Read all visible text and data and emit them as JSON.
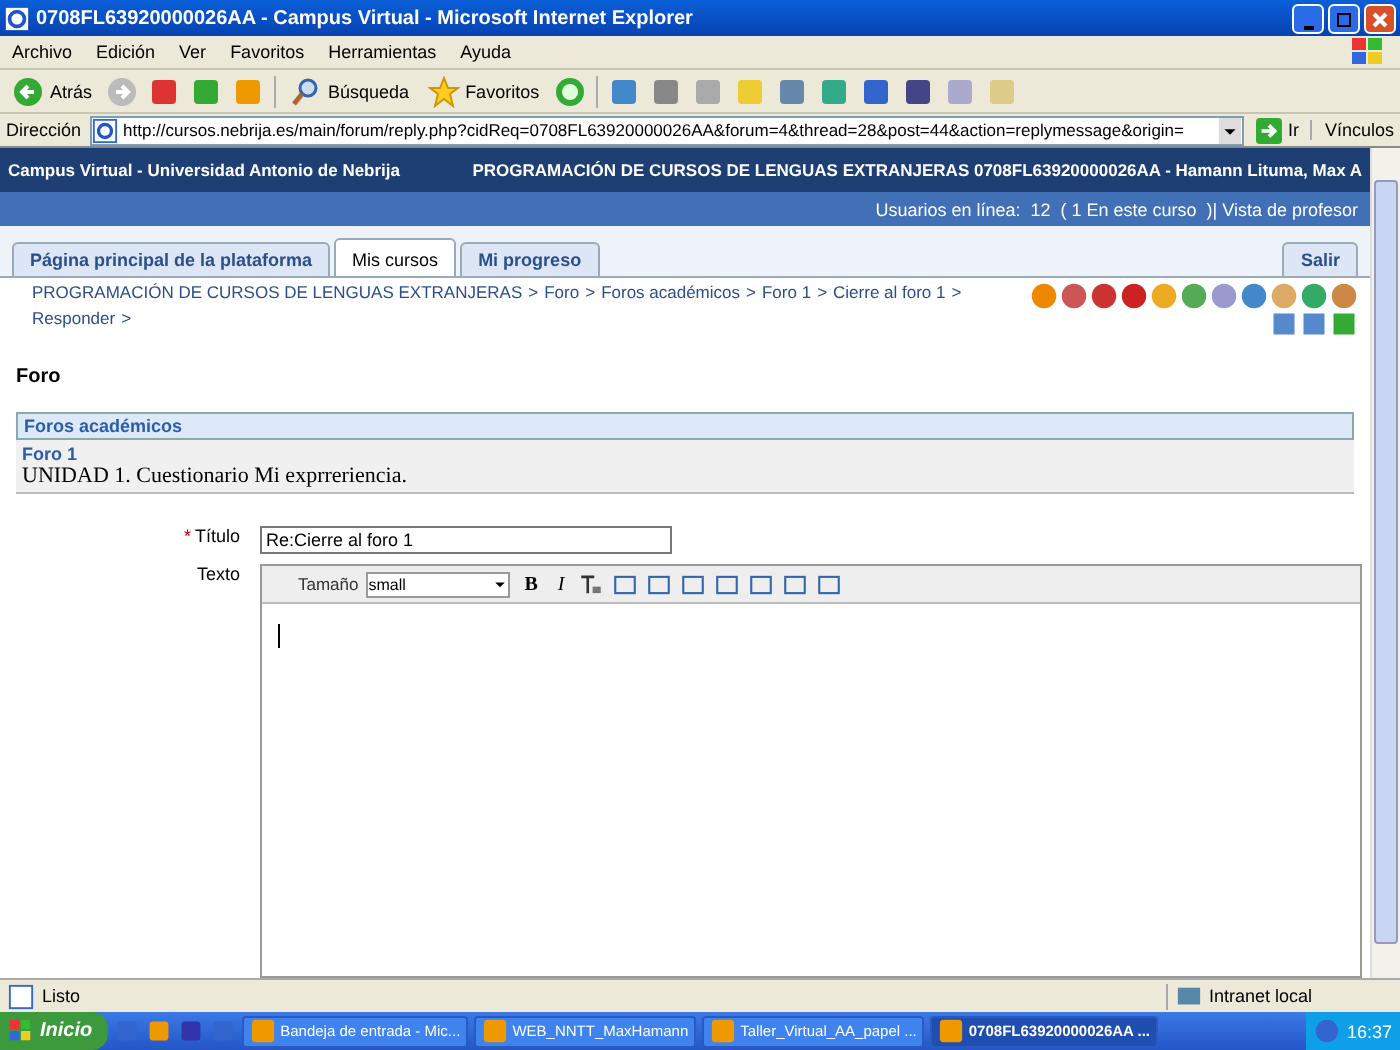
{
  "window": {
    "title": "0708FL63920000026AA - Campus Virtual - Microsoft Internet Explorer"
  },
  "menu": [
    "Archivo",
    "Edición",
    "Ver",
    "Favoritos",
    "Herramientas",
    "Ayuda"
  ],
  "toolbar": {
    "back": "Atrás",
    "search": "Búsqueda",
    "favorites": "Favoritos"
  },
  "address": {
    "label": "Dirección",
    "url": "http://cursos.nebrija.es/main/forum/reply.php?cidReq=0708FL63920000026AA&forum=4&thread=28&post=44&action=replymessage&origin=",
    "go": "Ir",
    "links": "Vínculos"
  },
  "header": {
    "site": "Campus Virtual - Universidad Antonio de Nebrija",
    "course": "PROGRAMACIÓN DE CURSOS DE LENGUAS EXTRANJERAS 0708FL63920000026AA - Hamann Lituma, Max A",
    "online": "Usuarios en línea:  12  ( 1 En este curso  )| Vista de profesor"
  },
  "tabs": [
    {
      "label": "Página principal de la plataforma",
      "selected": false
    },
    {
      "label": "Mis cursos",
      "selected": true
    },
    {
      "label": "Mi progreso",
      "selected": false
    }
  ],
  "logout": "Salir",
  "breadcrumb": {
    "separator": ">",
    "items": [
      "PROGRAMACIÓN DE CURSOS DE LENGUAS EXTRANJERAS",
      "Foro",
      "Foros académicos",
      "Foro 1",
      "Cierre al foro 1",
      "Responder"
    ]
  },
  "heading": "Foro",
  "forum": {
    "category": "Foros académicos",
    "name": "Foro 1",
    "description": "UNIDAD 1. Cuestionario Mi exprreriencia."
  },
  "form": {
    "required_mark": "*",
    "title_label": "Título",
    "title_value": "Re:Cierre al foro 1",
    "text_label": "Texto",
    "size_label": "Tamaño",
    "size_value": "small",
    "bold": "B",
    "italic": "I"
  },
  "status_bar": {
    "text": "Listo",
    "zone": "Intranet local"
  },
  "taskbar": {
    "start": "Inicio",
    "items": [
      {
        "label": "Bandeja de entrada - Mic...",
        "selected": false
      },
      {
        "label": "WEB_NNTT_MaxHamann",
        "selected": false
      },
      {
        "label": "Taller_Virtual_AA_papel ...",
        "selected": false
      },
      {
        "label": "0708FL63920000026AA ...",
        "selected": true
      }
    ],
    "clock": "16:37"
  }
}
